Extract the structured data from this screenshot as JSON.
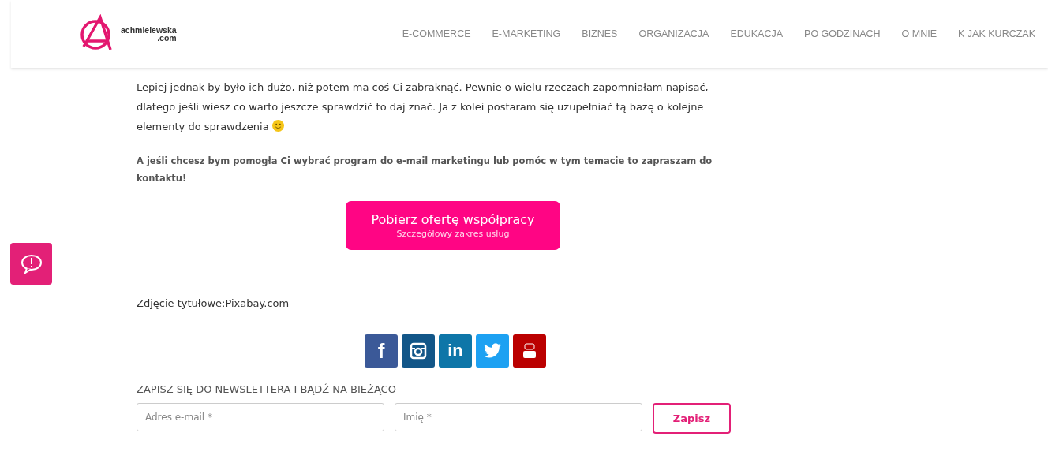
{
  "logo": {
    "name": "achmielewska",
    "domain": ".com"
  },
  "nav": [
    "E-COMMERCE",
    "E-MARKETING",
    "BIZNES",
    "ORGANIZACJA",
    "EDUKACJA",
    "PO GODZINACH",
    "O MNIE",
    "K JAK KURCZAK"
  ],
  "paragraph": "Lepiej jednak by było ich dużo, niż potem ma coś Ci zabraknąć. Pewnie o wielu rzeczach zapomniałam napisać, dlatego jeśli wiesz co warto jeszcze sprawdzić to daj znać. Ja z kolei postaram się uzupełniać tą bazę o kolejne elementy do sprawdzenia",
  "note": "A jeśli chcesz bym pomogła Ci wybrać program do e-mail marketingu lub pomóc w tym temacie to zapraszam do kontaktu!",
  "offer_button": {
    "title": "Pobierz ofertę współpracy",
    "subtitle": "Szczegółowy zakres usług"
  },
  "photo_credit": "Zdjęcie tytułowe:Pixabay.com",
  "social": [
    {
      "kind": "facebook",
      "text": "f"
    },
    {
      "kind": "instagram"
    },
    {
      "kind": "linkedin",
      "text": "in"
    },
    {
      "kind": "twitter"
    },
    {
      "kind": "youtube"
    }
  ],
  "newsletter": {
    "heading": "ZAPISZ SIĘ DO NEWSLETTERA I BĄDŹ NA BIEŻĄCO",
    "email_placeholder": "Adres e-mail *",
    "name_placeholder": "Imię *",
    "button": "Zapisz"
  }
}
